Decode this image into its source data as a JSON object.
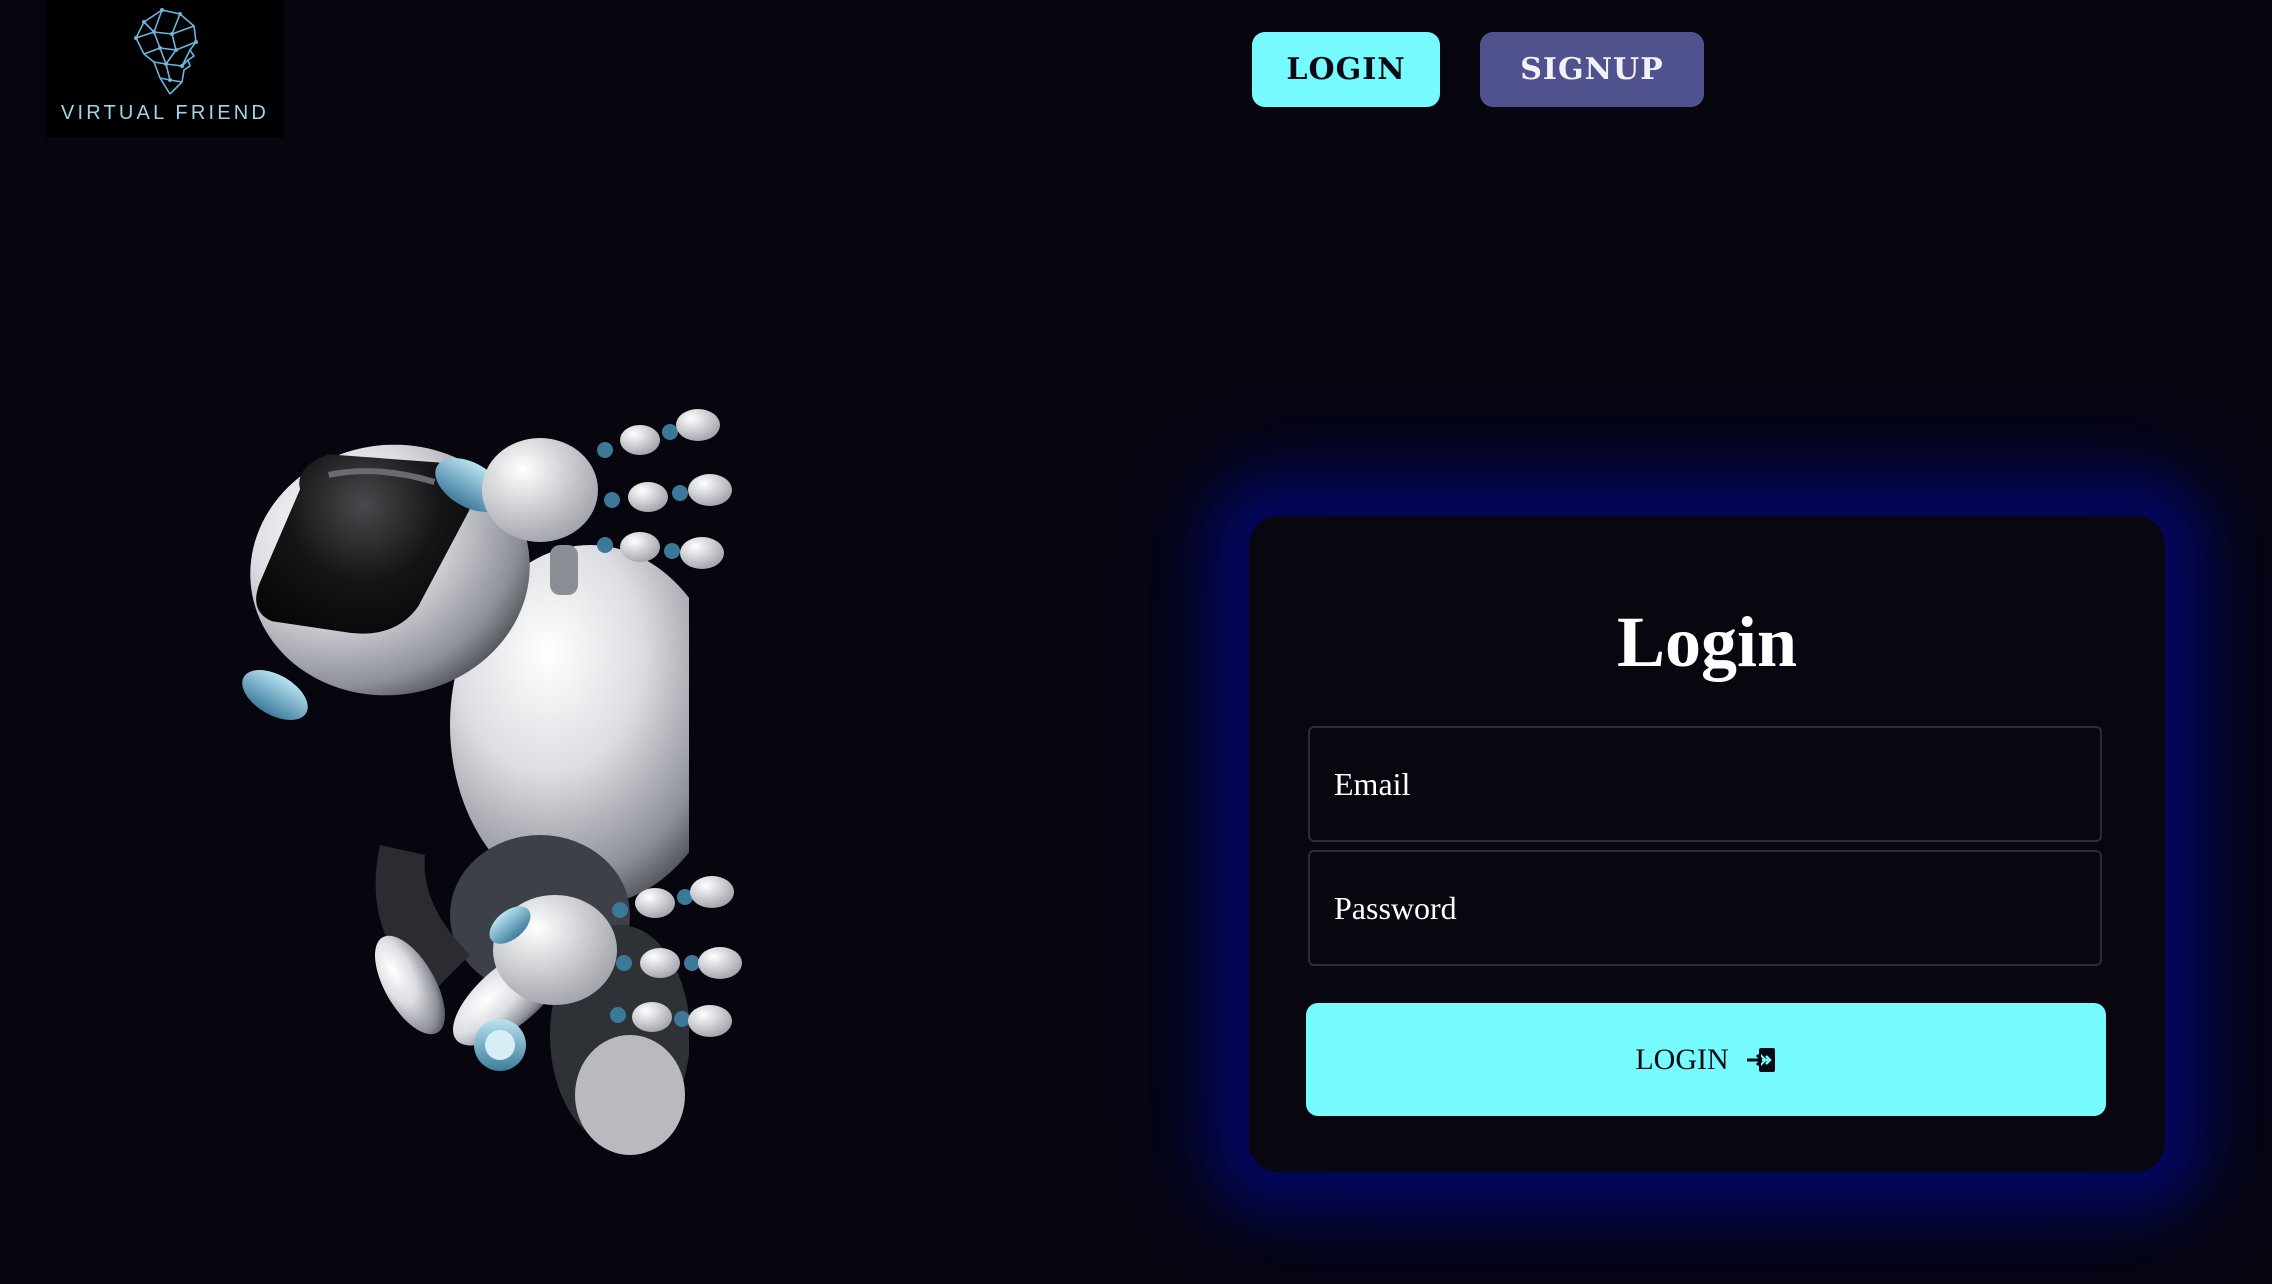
{
  "brand": {
    "logo_text": "VIRTUAL FRIEND",
    "logo_icon": "polygon-head-icon",
    "logo_color": "#9fd3ee"
  },
  "nav": {
    "login_label": "LOGIN",
    "signup_label": "SIGNUP"
  },
  "hero": {
    "illustration": "robot-peeking-illustration"
  },
  "login_form": {
    "title": "Login",
    "email_placeholder": "Email",
    "password_placeholder": "Password",
    "submit_label": "LOGIN",
    "submit_icon": "sign-in-icon"
  },
  "colors": {
    "background": "#07060e",
    "accent_cyan": "#75fbfd",
    "signup_purple": "#50528e",
    "card_glow": "#04086e"
  }
}
